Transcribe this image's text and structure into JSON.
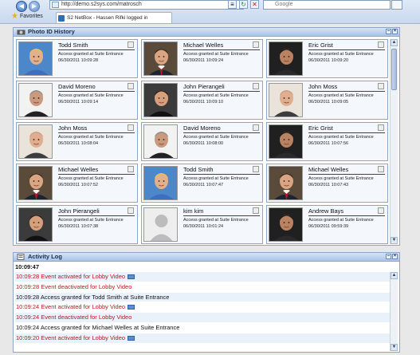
{
  "browser": {
    "address": "http://demo.s2sys.com/matrosch",
    "search_placeholder": "Google",
    "favorites_label": "Favorites",
    "tab_title": "S2 NetBox - Hassen Rifki logged in"
  },
  "photo_panel": {
    "title": "Photo ID History",
    "cards": [
      {
        "name": "Todd Smith",
        "message": "Access granted at Suite Entrance",
        "timestamp": "06/30/2011 10:09:28",
        "photo": "blond"
      },
      {
        "name": "Michael Welles",
        "message": "Access granted at Suite Entrance",
        "timestamp": "06/30/2011 10:09:24",
        "photo": "suit"
      },
      {
        "name": "Eric Grist",
        "message": "Access granted at Suite Entrance",
        "timestamp": "06/30/2011 10:09:20",
        "photo": "dark"
      },
      {
        "name": "David Moreno",
        "message": "Access granted at Suite Entrance",
        "timestamp": "06/30/2011 10:09:14",
        "photo": "gray"
      },
      {
        "name": "John Pierangeli",
        "message": "Access granted at Suite Entrance",
        "timestamp": "06/30/2011 10:09:10",
        "photo": "smile"
      },
      {
        "name": "John Moss",
        "message": "Access granted at Suite Entrance",
        "timestamp": "06/30/2011 10:09:05",
        "photo": "bald"
      },
      {
        "name": "John Moss",
        "message": "Access granted at Suite Entrance",
        "timestamp": "06/30/2011 10:08:04",
        "photo": "bald"
      },
      {
        "name": "David Moreno",
        "message": "Access granted at Suite Entrance",
        "timestamp": "06/30/2011 10:08:00",
        "photo": "gray"
      },
      {
        "name": "Eric Grist",
        "message": "Access granted at Suite Entrance",
        "timestamp": "06/30/2011 10:07:56",
        "photo": "dark"
      },
      {
        "name": "Michael Welles",
        "message": "Access granted at Suite Entrance",
        "timestamp": "06/30/2011 10:07:52",
        "photo": "suit"
      },
      {
        "name": "Todd Smith",
        "message": "Access granted at Suite Entrance",
        "timestamp": "06/30/2011 10:07:47",
        "photo": "blond"
      },
      {
        "name": "Michael Welles",
        "message": "Access granted at Suite Entrance",
        "timestamp": "06/30/2011 10:07:43",
        "photo": "suit"
      },
      {
        "name": "John Pierangeli",
        "message": "Access granted at Suite Entrance",
        "timestamp": "06/30/2011 10:07:38",
        "photo": "smile"
      },
      {
        "name": "kim kim",
        "message": "Access granted at Suite Entrance",
        "timestamp": "06/30/2011 10:01:24",
        "photo": "silhouette"
      },
      {
        "name": "Andrew Bays",
        "message": "Access granted at Suite Entrance",
        "timestamp": "06/30/2011 09:59:39",
        "photo": "dark"
      }
    ]
  },
  "activity_panel": {
    "title": "Activity Log",
    "current_time": "10:09:47",
    "entries": [
      {
        "text": "10:09:28 Event activated for Lobby Video",
        "color": "red",
        "has_video_icon": true,
        "alt": true
      },
      {
        "text": "10:09:28 Event deactivated for Lobby Video",
        "color": "red",
        "has_video_icon": false,
        "alt": false
      },
      {
        "text": "10:09:28 Access granted for Todd Smith at Suite Entrance",
        "color": "black",
        "has_video_icon": false,
        "alt": true
      },
      {
        "text": "10:09:24 Event activated for Lobby Video",
        "color": "red",
        "has_video_icon": true,
        "alt": false
      },
      {
        "text": "10:09:24 Event deactivated for Lobby Video",
        "color": "red",
        "has_video_icon": false,
        "alt": true
      },
      {
        "text": "10:09:24 Access granted for Michael Welles at Suite Entrance",
        "color": "black",
        "has_video_icon": false,
        "alt": false
      },
      {
        "text": "10:09:20 Event activated for Lobby Video",
        "color": "red",
        "has_video_icon": true,
        "alt": true
      }
    ]
  },
  "colors": {
    "accent": "#a9c4e6",
    "error_red": "#c4121a",
    "row_alt": "#e9f1fb"
  }
}
